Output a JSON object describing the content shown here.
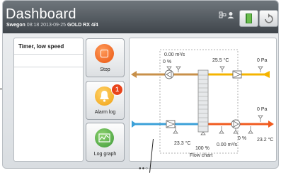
{
  "header": {
    "title": "Dashboard",
    "brand": "Swegon",
    "datetime": "08:18 2013-09-25",
    "unit": "GOLD RX",
    "unit_num": "4/4"
  },
  "mode_panel": {
    "mode": "Timer, low speed"
  },
  "tiles": {
    "stop": "Stop",
    "alarm": "Alarm log",
    "alarm_count": "1",
    "log": "Log graph"
  },
  "flow_chart": {
    "label": "Flow chart",
    "exhaust_flow": "0.00 m³/s",
    "exhaust_fan_pct": "0 %",
    "extract_temp": "25.5 °C",
    "extract_pressure": "0 Pa",
    "supply_pressure": "0 Pa",
    "outdoor_temp": "23.3 °C",
    "exchanger_pct": "100 %",
    "supply_flow": "0.00 m³/s",
    "supply_fan_pct": "0 %",
    "supply_temp": "23.2 °C"
  },
  "colors": {
    "exhaust": "#c8904a",
    "extract": "#f5b400",
    "outdoor": "#3ba0d8",
    "supply": "#f05a1e",
    "stop_icon": "#f2651c",
    "alarm_icon": "#f4a81d",
    "log_icon": "#4ea64a"
  },
  "pager": "●●○",
  "icons": [
    "hierarchy-icon",
    "user-icon",
    "door-icon",
    "refresh-icon",
    "stop-icon",
    "bell-icon",
    "graph-icon",
    "fan-icon",
    "filter-icon",
    "heat-exchanger-icon"
  ]
}
